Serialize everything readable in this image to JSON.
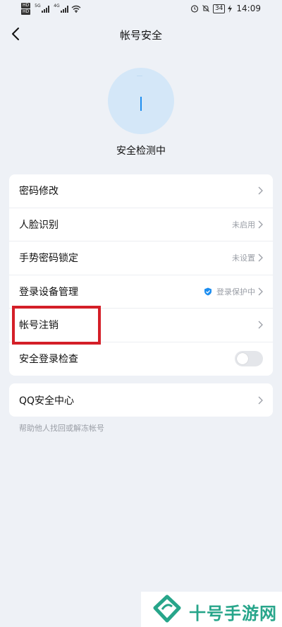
{
  "status_bar": {
    "hd1": "HD",
    "hd2": "HD",
    "net1": "5G",
    "net2": "4G",
    "battery": "34",
    "time": "14:09"
  },
  "nav": {
    "title": "帐号安全"
  },
  "detect": {
    "status_text": "安全检测中"
  },
  "menu": {
    "items": [
      {
        "label": "密码修改",
        "status": ""
      },
      {
        "label": "人脸识别",
        "status": "未启用"
      },
      {
        "label": "手势密码锁定",
        "status": "未设置"
      },
      {
        "label": "登录设备管理",
        "status": "登录保护中"
      },
      {
        "label": "帐号注销",
        "status": ""
      },
      {
        "label": "安全登录检查",
        "status": ""
      }
    ],
    "toggle_on": false
  },
  "qq_card": {
    "label": "QQ安全中心",
    "help": "帮助他人找回或解冻帐号"
  },
  "watermark": {
    "text": "十号手游网"
  },
  "colors": {
    "accent": "#1d8ef0",
    "highlight": "#d41f28",
    "watermark": "#27a58a"
  }
}
